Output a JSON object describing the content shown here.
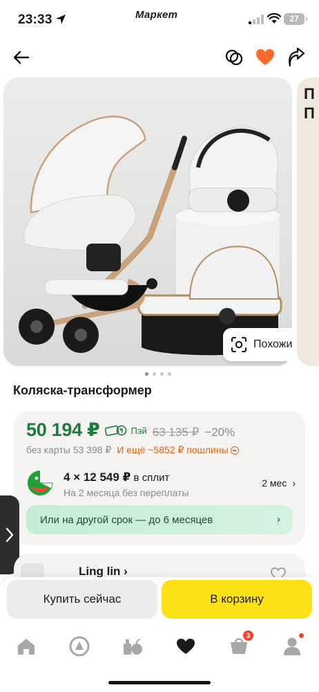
{
  "status_bar": {
    "time": "23:33",
    "app_name": "Маркет",
    "battery": "27"
  },
  "icons": {
    "back": "arrow-left-icon",
    "compare": "compare-circles-icon",
    "favorite": "heart-icon",
    "share": "share-arrow-icon",
    "similar": "scan-icon"
  },
  "gallery": {
    "similar_label": "Похожие",
    "next_photo_text": "П\nП",
    "dots_count": 4,
    "active_dot": 0
  },
  "product": {
    "title": "Коляска-трансформер"
  },
  "price": {
    "current": "50 194 ₽",
    "pay_label": "Пэй",
    "old": "63 135 ₽",
    "discount": "−20%",
    "no_card": "без карты 53 398 ₽",
    "duty": "И ещё ~5852 ₽ пошлины"
  },
  "split": {
    "amount": "4 × 12 549 ₽",
    "suffix": " в сплит",
    "subtitle": "На 2 месяца без переплаты",
    "term": "2 мес",
    "other_term": "Или на другой срок — до 6 месяцев"
  },
  "seller": {
    "name": "Ling lin ›"
  },
  "actions": {
    "buy_now": "Купить сейчас",
    "to_cart": "В корзину"
  },
  "tab_bar": {
    "cart_badge": "3"
  },
  "colors": {
    "price_green": "#1e7b3e",
    "duty_orange": "#e8610d",
    "cart_yellow": "#fbe116",
    "favorite_orange": "#fd6a2b",
    "badge_red": "#f2422d"
  }
}
